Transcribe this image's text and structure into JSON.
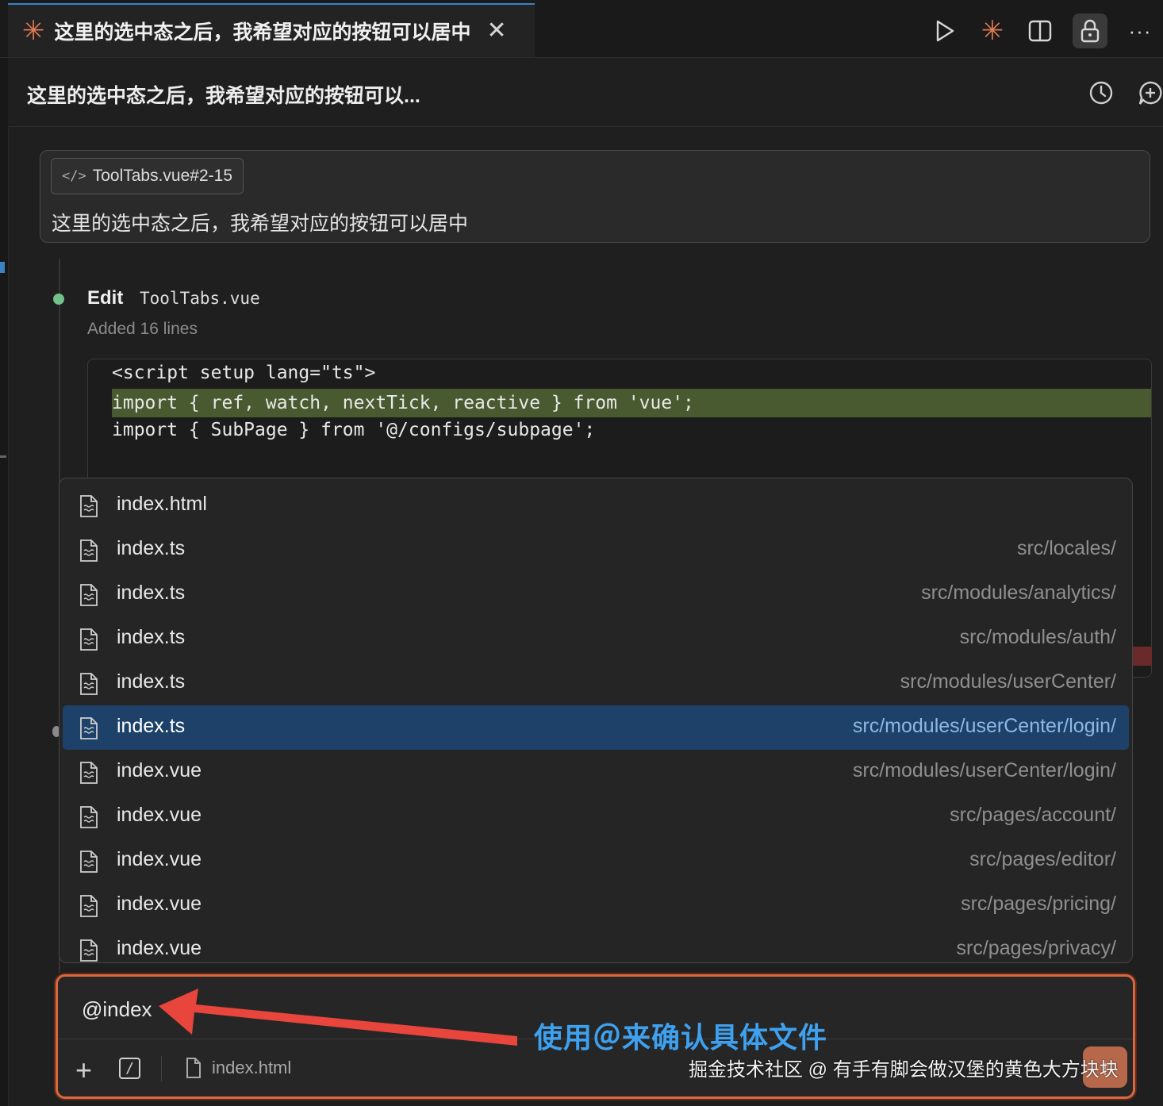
{
  "tab": {
    "title": "这里的选中态之后，我希望对应的按钮可以居中",
    "close_glyph": "✕"
  },
  "toolbar": {
    "icons": [
      "play-icon",
      "claude-star-icon",
      "split-panel-icon",
      "lock-icon",
      "more-icon"
    ],
    "more_glyph": "···"
  },
  "header": {
    "title": "这里的选中态之后，我希望对应的按钮可以..."
  },
  "prompt": {
    "chip_label": "ToolTabs.vue#2-15",
    "text": "这里的选中态之后，我希望对应的按钮可以居中"
  },
  "edit": {
    "action": "Edit",
    "file": "ToolTabs.vue",
    "summary": "Added 16 lines"
  },
  "code": {
    "lines": [
      "<script setup lang=\"ts\">",
      "import { ref, watch, nextTick, reactive } from 'vue';",
      "import { SubPage } from '@/configs/subpage';"
    ]
  },
  "dropdown": {
    "items": [
      {
        "name": "index.html",
        "path": "",
        "selected": false
      },
      {
        "name": "index.ts",
        "path": "src/locales/",
        "selected": false
      },
      {
        "name": "index.ts",
        "path": "src/modules/analytics/",
        "selected": false
      },
      {
        "name": "index.ts",
        "path": "src/modules/auth/",
        "selected": false
      },
      {
        "name": "index.ts",
        "path": "src/modules/userCenter/",
        "selected": false
      },
      {
        "name": "index.ts",
        "path": "src/modules/userCenter/login/",
        "selected": true
      },
      {
        "name": "index.vue",
        "path": "src/modules/userCenter/login/",
        "selected": false
      },
      {
        "name": "index.vue",
        "path": "src/pages/account/",
        "selected": false
      },
      {
        "name": "index.vue",
        "path": "src/pages/editor/",
        "selected": false
      },
      {
        "name": "index.vue",
        "path": "src/pages/pricing/",
        "selected": false
      },
      {
        "name": "index.vue",
        "path": "src/pages/privacy/",
        "selected": false
      }
    ]
  },
  "input": {
    "value": "@index",
    "plus_glyph": "+",
    "slash_glyph": "/",
    "attached_file": "index.html",
    "send_glyph": "↑"
  },
  "annotation": {
    "text": "使用＠来确认具体文件",
    "arrow_color": "#e8453c"
  },
  "watermark": "掘金技术社区 @ 有手有脚会做汉堡的黄色大方块块",
  "colors": {
    "accent_orange": "#d9673f",
    "selection_blue": "#1d4168",
    "diff_green": "#4a5a30",
    "status_green": "#72c08a"
  }
}
